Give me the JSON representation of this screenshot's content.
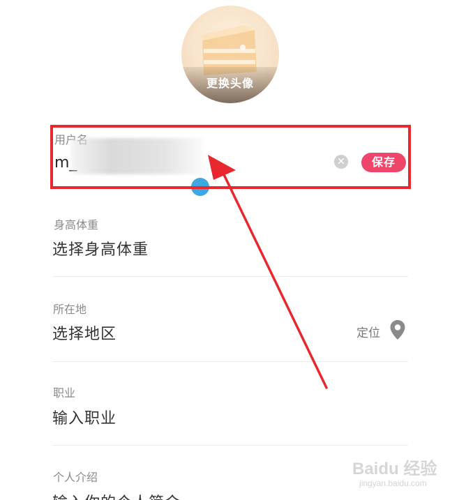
{
  "avatar": {
    "change_label": "更换头像"
  },
  "username": {
    "label": "用户名",
    "value": "m_",
    "save_label": "保存",
    "clear_glyph": "✕"
  },
  "height_weight": {
    "label": "身高体重",
    "placeholder": "选择身高体重"
  },
  "location": {
    "label": "所在地",
    "placeholder": "选择地区",
    "locate_label": "定位",
    "locate_icon": "map-pin-icon"
  },
  "occupation": {
    "label": "职业",
    "placeholder": "输入职业"
  },
  "bio": {
    "label": "个人介绍",
    "placeholder": "输入你的个人简介"
  },
  "watermark": {
    "main": "Baidu 经验",
    "sub": "jingyan.baidu.com"
  },
  "colors": {
    "accent": "#f0456b",
    "annotation": "#e8282e",
    "cursor": "#3fa7e0"
  }
}
